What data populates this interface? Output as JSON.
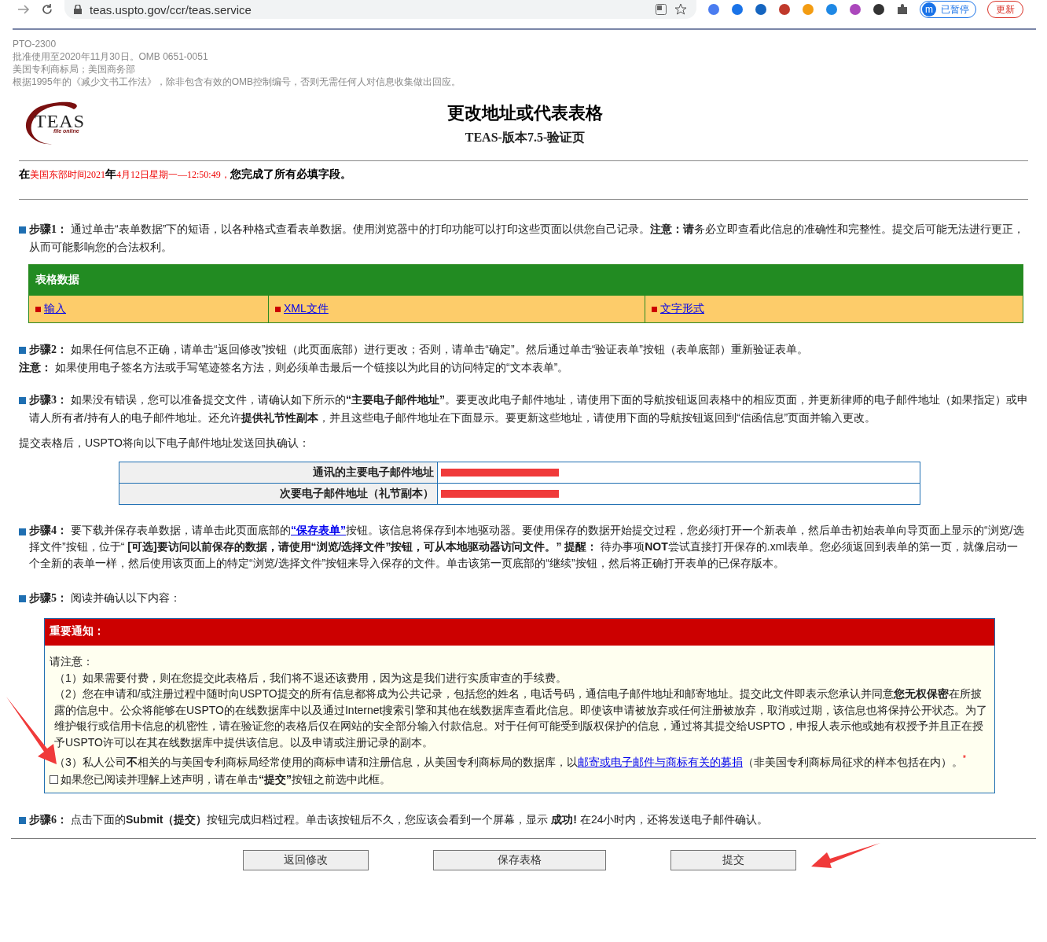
{
  "browser": {
    "url": "teas.uspto.gov/ccr/teas.service",
    "profile_initial": "m",
    "profile_status": "已暂停",
    "update_label": "更新"
  },
  "header_lines": [
    "PTO-2300",
    "批准使用至2020年11月30日。OMB 0651-0051",
    "美国专利商标局；美国商务部",
    "根据1995年的《减少文书工作法》，除非包含有效的OMB控制编号，否则无需任何人对信息收集做出回应。"
  ],
  "logo": {
    "text": "TEAS",
    "tagline": "file online"
  },
  "title": "更改地址或代表表格",
  "subtitle": "TEAS-版本7.5-验证页",
  "completion": [
    {
      "kind": "label",
      "text": "在"
    },
    {
      "kind": "value",
      "text": "美国东部时间2021"
    },
    {
      "kind": "label",
      "text": "年"
    },
    {
      "kind": "value",
      "text": "4月12日星期一—12:50:49，"
    },
    {
      "kind": "label",
      "text": "您完成了所有必填字段。"
    }
  ],
  "step1": {
    "label": "步骤1：",
    "text": "通过单击“表单数据”下的短语，以各种格式查看表单数据。使用浏览器中的打印功能可以打印这些页面以供您自己记录。**注意：请**务必立即查看此信息的准确性和完整性。提交后可能无法进行更正，从而可能影响您的合法权利。"
  },
  "form_data": {
    "title": "表格数据",
    "links": [
      "输入",
      "XML文件",
      "文字形式"
    ]
  },
  "step2": {
    "label": "步骤2：",
    "text": "如果任何信息不正确，请单击“返回修改”按钮（此页面底部）进行更改；否则，请单击“确定”。然后通过单击“验证表单”按钮（表单底部）重新验证表单。",
    "note_label": "注意：",
    "note_text": "如果使用电子签名方法或手写笔迹签名方法，则必须单击最后一个链接以为此目的访问特定的“文本表单”。"
  },
  "step3": {
    "label": "步骤3：",
    "text": "如果没有错误，您可以准备提交文件，请确认如下所示的**“主要电子邮件地址”**。要更改此电子邮件地址，请使用下面的导航按钮返回表格中的相应页面，并更新律师的电子邮件地址（如果指定）或申请人所有者/持有人的电子邮件地址。还允许**提供礼节性副本**，并且这些电子邮件地址在下面显示。要更新这些地址，请使用下面的导航按钮返回到“信函信息”页面并输入更改。",
    "confirm_text": "提交表格后，USPTO将向以下电子邮件地址发送回执确认："
  },
  "emails": [
    {
      "label": "通讯的主要电子邮件地址"
    },
    {
      "label": "次要电子邮件地址（礼节副本）"
    }
  ],
  "step4": {
    "label": "步骤4：",
    "before": "要下载并保存表单数据，请单击此页面底部的",
    "link": "“保存表单”",
    "after": "按钮。该信息将保存到本地驱动器。要使用保存的数据开始提交过程，您必须打开一个新表单，然后单击初始表单向导页面上显示的“浏览/选择文件”按钮，位于“ **[可选]要访问以前保存的数据，请使用“浏览/选择文件”按钮，可从本地驱动器访问文件。” 提醒：** 待办事项**NOT**尝试直接打开保存的.xml表单。您必须返回到表单的第一页，就像启动一个全新的表单一样，然后使用该页面上的特定“浏览/选择文件”按钮来导入保存的文件。单击该第一页底部的“继续”按钮，然后将正确打开表单的已保存版本。"
  },
  "step5": {
    "label": "步骤5：",
    "text": "阅读并确认以下内容："
  },
  "notice": {
    "title": "重要通知：",
    "intro": "请注意：",
    "item1": "（1）如果需要付费，则在您提交此表格后，我们将不退还该费用，因为这是我们进行实质审查的手续费。",
    "item2": "（2）您在申请和/或注册过程中随时向USPTO提交的所有信息都将成为公共记录，包括您的姓名，电话号码，通信电子邮件地址和邮寄地址。提交此文件即表示您承认并同意**您无权保密**在所披露的信息中。公众将能够在USPTO的在线数据库中以及通过Internet搜索引擎和其他在线数据库查看此信息。即使该申请被放弃或任何注册被放弃，取消或过期，该信息也将保持公开状态。为了维护银行或信用卡信息的机密性，请在验证您的表格后仅在网站的安全部分输入付款信息。对于任何可能受到版权保护的信息，通过将其提交给USPTO，申报人表示他或她有权授予并且正在授予USPTO许可以在其在线数据库中提供该信息。以及申请或注册记录的副本。",
    "item3_before": "（3）私人公司**不**相关的与美国专利商标局经常使用的商标申请和注册信息，从美国专利商标局的数据库，以",
    "item3_link": "邮寄或电子邮件与商标有关的募捐",
    "item3_after": "（非美国专利商标局征求的样本包括在内）。",
    "required_mark": "*",
    "checkbox": {
      "label": "如果您已阅读并理解上述声明，请在单击**“提交”**按钮之前选中此框。",
      "checked": false
    }
  },
  "step6": {
    "label": "步骤6：",
    "text": "点击下面的**Submit（提交）**按钮完成归档过程。单击该按钮后不久，您应该会看到一个屏幕，显示 **成功!** 在24小时内，还将发送电子邮件确认。"
  },
  "buttons": [
    "返回修改",
    "保存表格",
    "提交"
  ]
}
